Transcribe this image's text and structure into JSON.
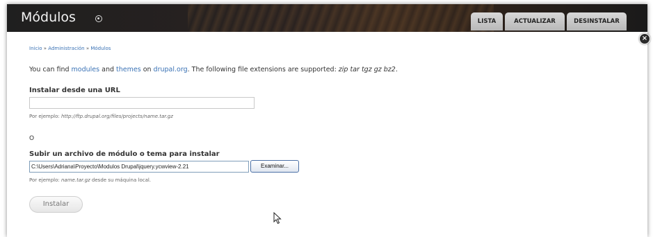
{
  "window": {
    "title": "Módulos",
    "tabs": [
      "LISTA",
      "ACTUALIZAR",
      "DESINSTALAR"
    ]
  },
  "breadcrumb": [
    "Inicio",
    "Administración",
    "Módulos"
  ],
  "intro": {
    "part1": "You can find ",
    "link_modules": "modules",
    "part2": " and ",
    "link_themes": "themes",
    "part3": " on ",
    "link_drupal": "drupal.org",
    "part4": ". The following file extensions are supported: ",
    "extensions": "zip tar tgz gz bz2",
    "part5": "."
  },
  "url_section": {
    "label": "Instalar desde una URL",
    "value": "",
    "hint_prefix": "Por ejemplo: ",
    "hint_example": "http://ftp.drupal.org/files/projects/name.tar.gz"
  },
  "or_text": "O",
  "upload_section": {
    "label": "Subir un archivo de módulo o tema para instalar",
    "file_path": "C:\\Users\\Adriana\\Proyecto\\Modulos Drupal\\jquery.ycwview-2.21",
    "browse_label": "Examinar...",
    "hint_prefix": "Por ejemplo: ",
    "hint_example": "name.tar.gz",
    "hint_suffix": " desde su máquina local."
  },
  "install_button": "Instalar",
  "colors": {
    "link": "#3a72b5",
    "titlebar": "#1f1f1f",
    "tab_bg": "#c8c8c8"
  }
}
